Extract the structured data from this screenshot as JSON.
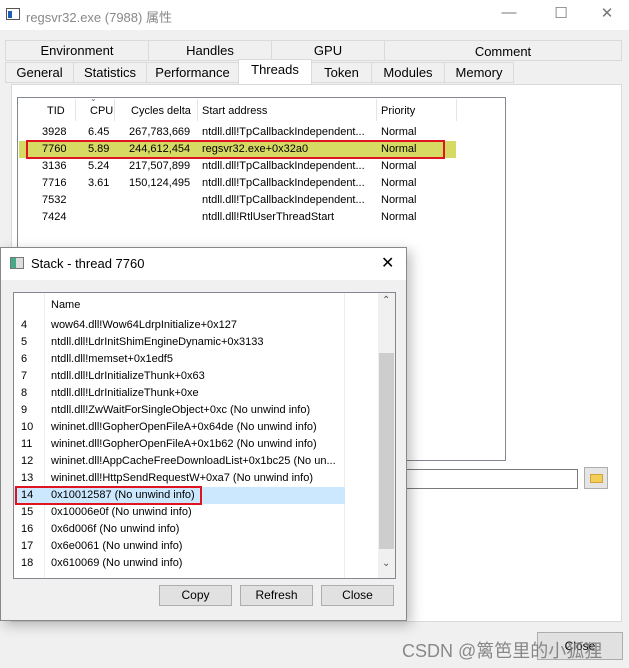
{
  "window": {
    "title": "regsvr32.exe (7988) 属性",
    "controls": [
      "minimize",
      "maximize",
      "close"
    ]
  },
  "tabs_row1": [
    "Environment",
    "Handles",
    "GPU",
    "Comment"
  ],
  "tabs_row2": [
    "General",
    "Statistics",
    "Performance",
    "Threads",
    "Token",
    "Modules",
    "Memory"
  ],
  "active_tab": "Threads",
  "threads": {
    "columns": [
      "TID",
      "CPU",
      "Cycles delta",
      "Start address",
      "Priority"
    ],
    "sort_column": "CPU",
    "rows": [
      {
        "tid": "3928",
        "cpu": "6.45",
        "cycles": "267,783,669",
        "start": "ntdll.dll!TpCallbackIndependent...",
        "priority": "Normal"
      },
      {
        "tid": "7760",
        "cpu": "5.89",
        "cycles": "244,612,454",
        "start": "regsvr32.exe+0x32a0",
        "priority": "Normal"
      },
      {
        "tid": "3136",
        "cpu": "5.24",
        "cycles": "217,507,899",
        "start": "ntdll.dll!TpCallbackIndependent...",
        "priority": "Normal"
      },
      {
        "tid": "7716",
        "cpu": "3.61",
        "cycles": "150,124,495",
        "start": "ntdll.dll!TpCallbackIndependent...",
        "priority": "Normal"
      },
      {
        "tid": "7532",
        "cpu": "",
        "cycles": "",
        "start": "ntdll.dll!TpCallbackIndependent...",
        "priority": "Normal"
      },
      {
        "tid": "7424",
        "cpu": "",
        "cycles": "",
        "start": "ntdll.dll!RtlUserThreadStart",
        "priority": "Normal"
      }
    ],
    "selected_color": "#d6da62"
  },
  "main_close": "Close",
  "stack": {
    "title": "Stack - thread 7760",
    "column": "Name",
    "rows": [
      {
        "n": "4",
        "name": "wow64.dll!Wow64LdrpInitialize+0x127"
      },
      {
        "n": "5",
        "name": "ntdll.dll!LdrInitShimEngineDynamic+0x3133"
      },
      {
        "n": "6",
        "name": "ntdll.dll!memset+0x1edf5"
      },
      {
        "n": "7",
        "name": "ntdll.dll!LdrInitializeThunk+0x63"
      },
      {
        "n": "8",
        "name": "ntdll.dll!LdrInitializeThunk+0xe"
      },
      {
        "n": "9",
        "name": "ntdll.dll!ZwWaitForSingleObject+0xc (No unwind info)"
      },
      {
        "n": "10",
        "name": "wininet.dll!GopherOpenFileA+0x64de (No unwind info)"
      },
      {
        "n": "11",
        "name": "wininet.dll!GopherOpenFileA+0x1b62 (No unwind info)"
      },
      {
        "n": "12",
        "name": "wininet.dll!AppCacheFreeDownloadList+0x1bc25 (No un..."
      },
      {
        "n": "13",
        "name": "wininet.dll!HttpSendRequestW+0xa7 (No unwind info)"
      },
      {
        "n": "14",
        "name": "0x10012587 (No unwind info)"
      },
      {
        "n": "15",
        "name": "0x10006e0f (No unwind info)"
      },
      {
        "n": "16",
        "name": "0x6d006f (No unwind info)"
      },
      {
        "n": "17",
        "name": "0x6e0061 (No unwind info)"
      },
      {
        "n": "18",
        "name": "0x610069 (No unwind info)"
      }
    ],
    "buttons": {
      "copy": "Copy",
      "refresh": "Refresh",
      "close": "Close"
    }
  },
  "watermark": "CSDN @篱笆里的小狐狸",
  "highlight_color": "#e0141e"
}
